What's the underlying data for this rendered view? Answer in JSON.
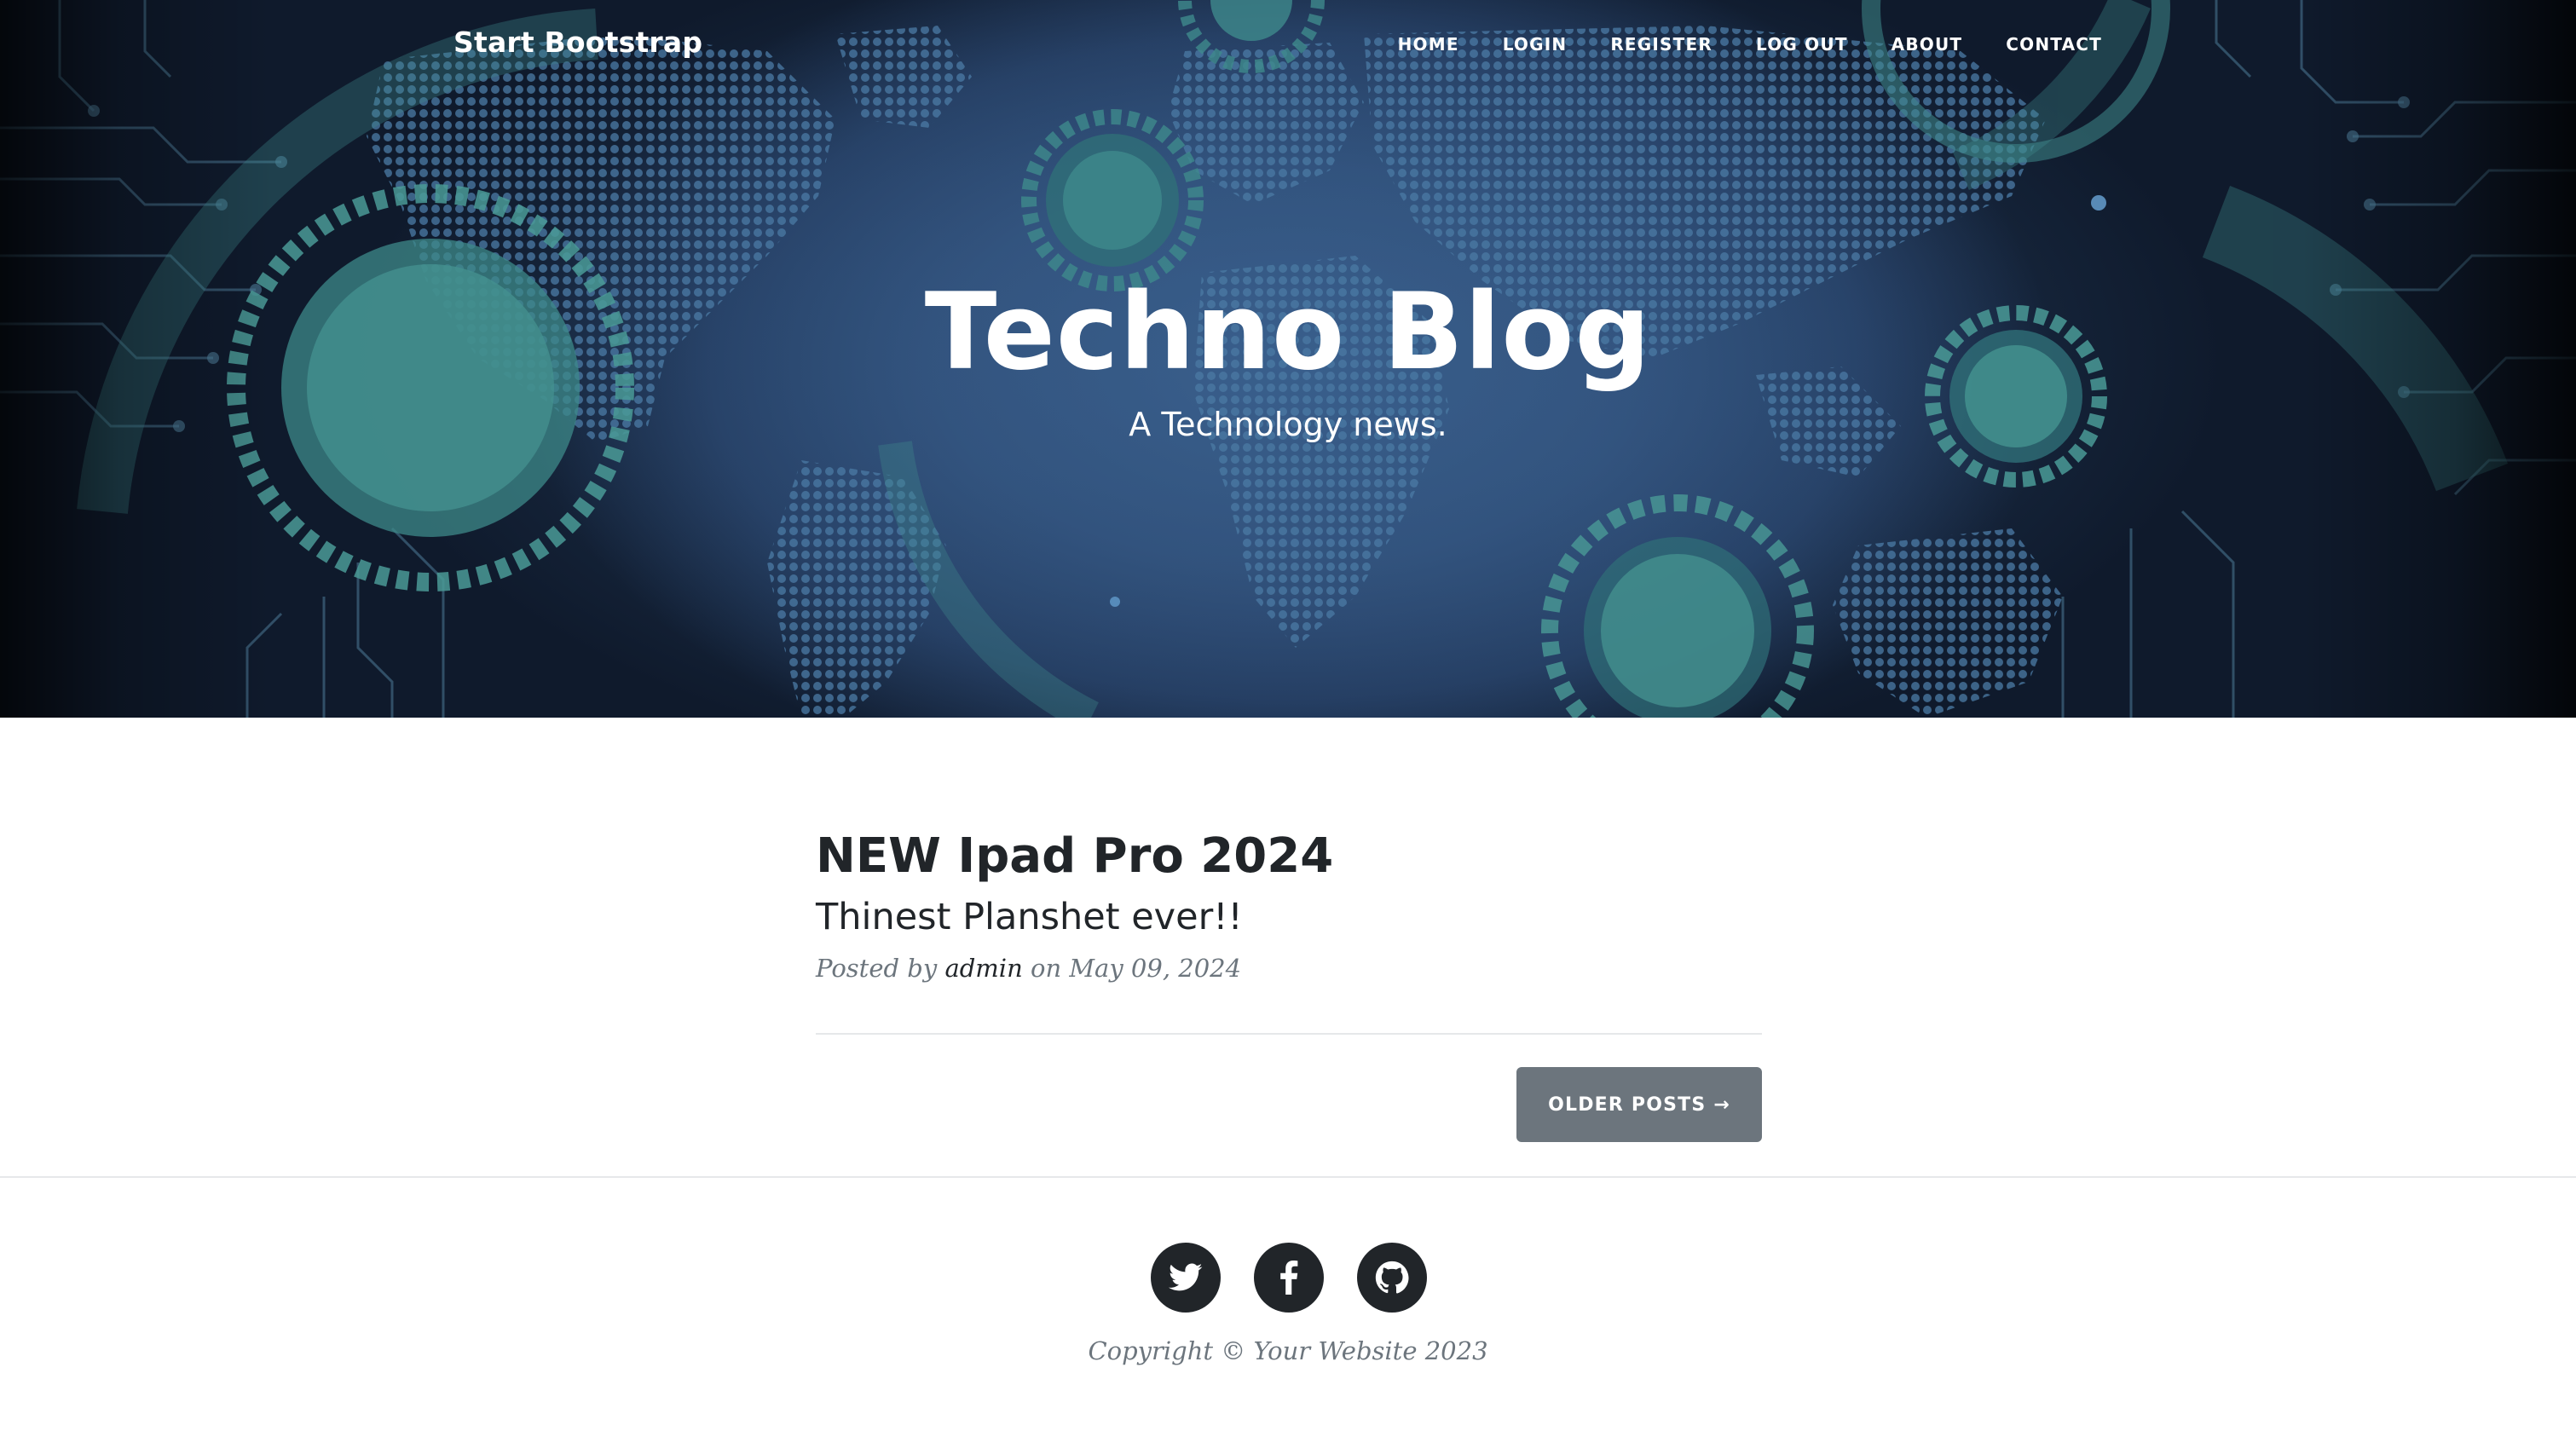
{
  "nav": {
    "brand": "Start Bootstrap",
    "links": [
      "HOME",
      "LOGIN",
      "REGISTER",
      "LOG OUT",
      "ABOUT",
      "CONTACT"
    ]
  },
  "hero": {
    "title": "Techno Blog",
    "subtitle": "A Technology news."
  },
  "posts": [
    {
      "title": "NEW Ipad Pro 2024",
      "subtitle": "Thinest Planshet ever!!",
      "meta_prefix": "Posted by",
      "author": "admin",
      "meta_on": "on May 09, 2024"
    }
  ],
  "pager": {
    "older_label": "OLDER POSTS →"
  },
  "footer": {
    "social": [
      "twitter-icon",
      "facebook-icon",
      "github-icon"
    ],
    "copyright": "Copyright © Your Website 2023"
  },
  "colors": {
    "accent_button": "#6c757d",
    "text_dark": "#212529",
    "meta_gray": "#6c757d",
    "hero_blue": "#2d4a72",
    "hero_teal": "#3f8a8c"
  }
}
